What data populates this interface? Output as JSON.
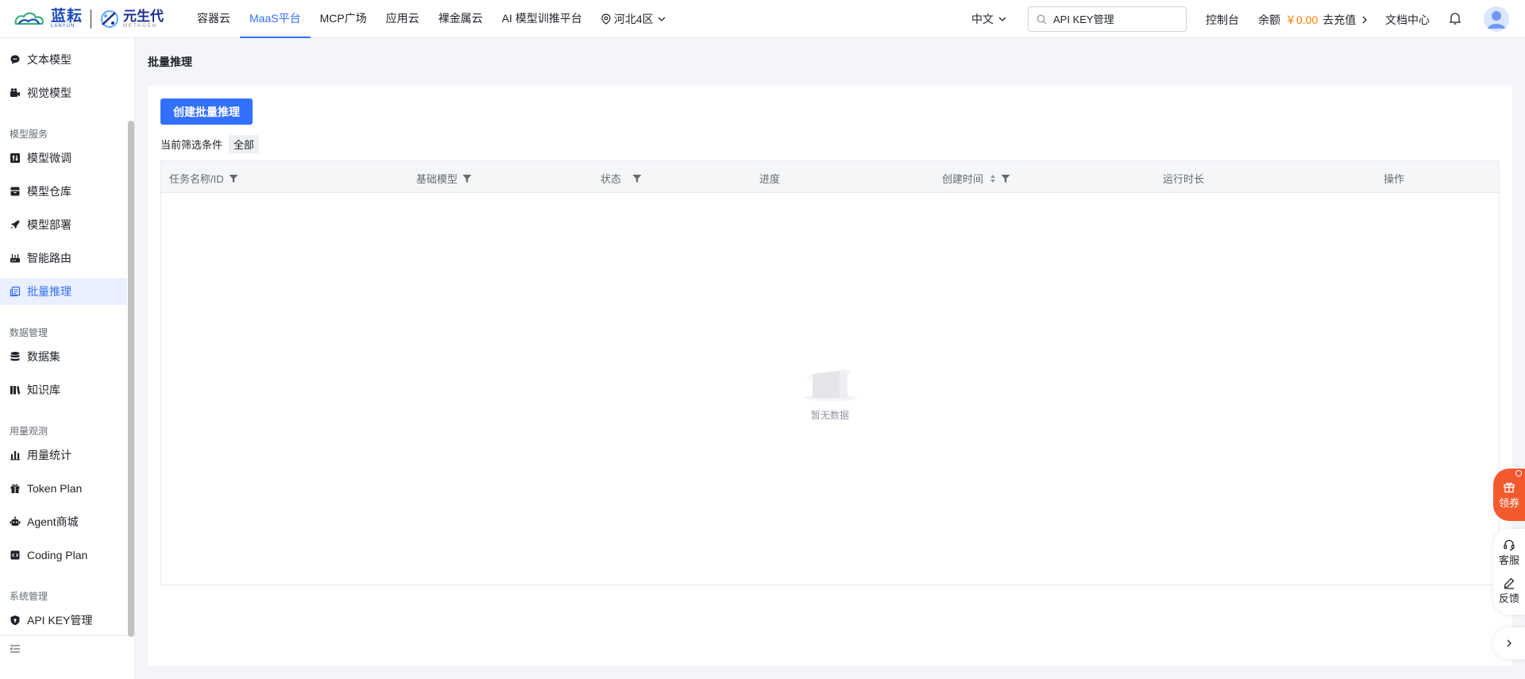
{
  "logo": {
    "brand1": "蓝耘",
    "brand1_sub": "LANYUN",
    "brand2": "元生代",
    "brand2_sub": "METAGEN"
  },
  "nav": {
    "items": [
      {
        "label": "容器云"
      },
      {
        "label": "MaaS平台",
        "active": true
      },
      {
        "label": "MCP广场"
      },
      {
        "label": "应用云"
      },
      {
        "label": "裸金属云"
      },
      {
        "label": "AI 模型训推平台"
      }
    ],
    "region": "河北4区"
  },
  "toolbar": {
    "language": "中文",
    "search_placeholder": "API KEY管理",
    "console": "控制台",
    "balance_label": "余额",
    "balance_amount": "￥0.00",
    "recharge": "去充值",
    "docs": "文档中心"
  },
  "sidebar": {
    "groups": [
      {
        "label": "模型服务"
      },
      {
        "label": "数据管理"
      },
      {
        "label": "用量观测"
      },
      {
        "label": "系统管理"
      }
    ],
    "items": [
      {
        "label": "文本模型"
      },
      {
        "label": "视觉模型"
      },
      {
        "label": "模型微调"
      },
      {
        "label": "模型仓库"
      },
      {
        "label": "模型部署"
      },
      {
        "label": "智能路由"
      },
      {
        "label": "批量推理",
        "active": true
      },
      {
        "label": "数据集"
      },
      {
        "label": "知识库"
      },
      {
        "label": "用量统计"
      },
      {
        "label": "Token Plan"
      },
      {
        "label": "Agent商城"
      },
      {
        "label": "Coding Plan"
      },
      {
        "label": "API KEY管理"
      }
    ]
  },
  "main": {
    "title": "批量推理",
    "create_button": "创建批量推理",
    "filter_label": "当前筛选条件",
    "filter_value": "全部",
    "table": {
      "columns": [
        {
          "label": "任务名称/ID",
          "filter": true
        },
        {
          "label": "基础模型",
          "filter": true
        },
        {
          "label": "状态",
          "filter": true
        },
        {
          "label": "进度"
        },
        {
          "label": "创建时间",
          "sort": true,
          "filter": true
        },
        {
          "label": "运行时长"
        },
        {
          "label": "操作"
        }
      ],
      "empty_text": "暂无数据"
    }
  },
  "float": {
    "coupon": "领券",
    "service": "客服",
    "feedback": "反馈"
  },
  "colors": {
    "accent": "#3370ff",
    "amount": "#ff7d00",
    "coupon": "#f25a2e"
  }
}
